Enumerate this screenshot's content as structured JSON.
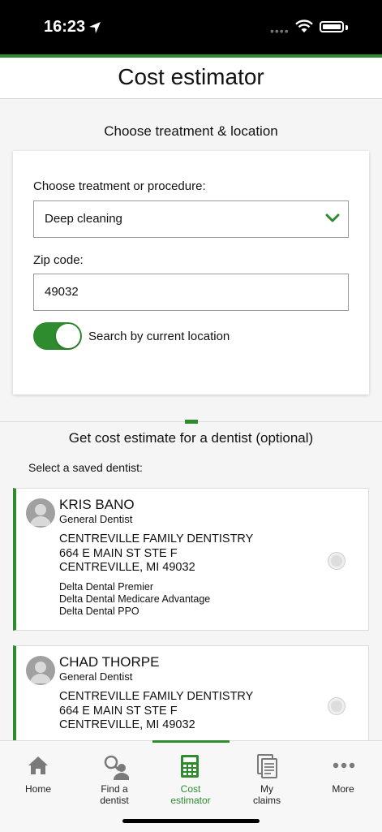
{
  "status": {
    "time": "16:23"
  },
  "header": {
    "title": "Cost estimator"
  },
  "treatment_section": {
    "title": "Choose treatment & location",
    "procedure_label": "Choose treatment or procedure:",
    "procedure_value": "Deep cleaning",
    "zip_label": "Zip code:",
    "zip_value": "49032",
    "location_toggle_label": "Search by current location",
    "location_toggle_on": true
  },
  "dentist_section": {
    "title": "Get cost estimate for a dentist (optional)",
    "subtitle": "Select a saved dentist:",
    "dentists": [
      {
        "name": "KRIS BANO",
        "role": "General Dentist",
        "practice": "CENTREVILLE FAMILY DENTISTRY",
        "address1": "664 E MAIN ST STE F",
        "address2": "CENTREVILLE, MI 49032",
        "plans": [
          "Delta Dental Premier",
          "Delta Dental Medicare Advantage",
          "Delta Dental PPO"
        ]
      },
      {
        "name": "CHAD THORPE",
        "role": "General Dentist",
        "practice": "CENTREVILLE FAMILY DENTISTRY",
        "address1": "664 E MAIN ST STE F",
        "address2": "CENTREVILLE, MI 49032",
        "plans": []
      }
    ]
  },
  "tabbar": {
    "active": "cost-estimator",
    "tabs": [
      {
        "line1": "Home",
        "line2": "",
        "icon": "home-icon"
      },
      {
        "line1": "Find a",
        "line2": "dentist",
        "icon": "find-dentist-icon"
      },
      {
        "line1": "Cost",
        "line2": "estimator",
        "icon": "calculator-icon"
      },
      {
        "line1": "My",
        "line2": "claims",
        "icon": "claims-icon"
      },
      {
        "line1": "More",
        "line2": "",
        "icon": "more-icon"
      }
    ]
  },
  "colors": {
    "accent": "#2e8b2e",
    "background": "#f5f5f5"
  }
}
